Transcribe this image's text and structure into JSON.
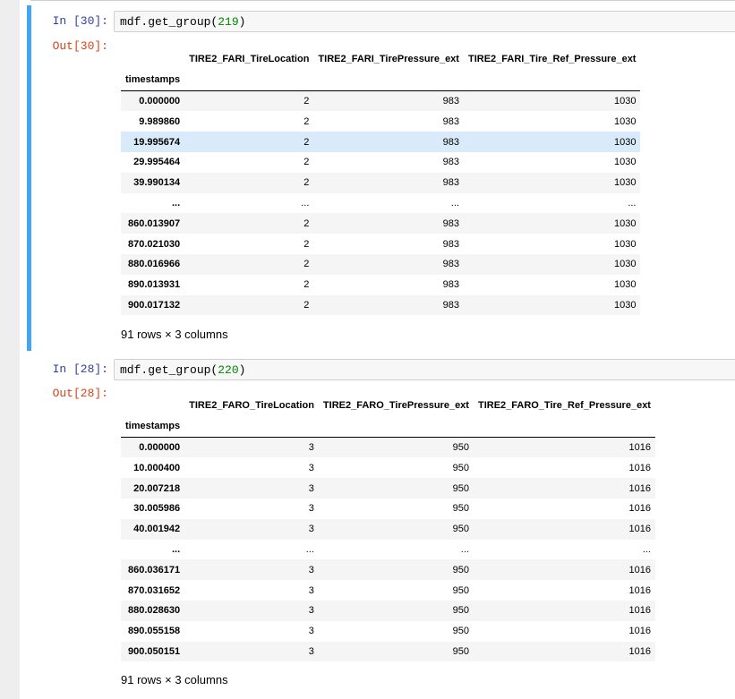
{
  "cell1": {
    "in_prompt": "In [30]:",
    "code_prefix": "mdf.get_group(",
    "code_arg": "219",
    "code_suffix": ")",
    "out_prompt": "Out[30]:",
    "index_name": "timestamps",
    "columns": [
      "TIRE2_FARI_TireLocation",
      "TIRE2_FARI_TirePressure_ext",
      "TIRE2_FARI_Tire_Ref_Pressure_ext"
    ],
    "rows": [
      [
        "0.000000",
        "2",
        "983",
        "1030"
      ],
      [
        "9.989860",
        "2",
        "983",
        "1030"
      ],
      [
        "19.995674",
        "2",
        "983",
        "1030"
      ],
      [
        "29.995464",
        "2",
        "983",
        "1030"
      ],
      [
        "39.990134",
        "2",
        "983",
        "1030"
      ],
      [
        "...",
        "...",
        "...",
        "..."
      ],
      [
        "860.013907",
        "2",
        "983",
        "1030"
      ],
      [
        "870.021030",
        "2",
        "983",
        "1030"
      ],
      [
        "880.016966",
        "2",
        "983",
        "1030"
      ],
      [
        "890.013931",
        "2",
        "983",
        "1030"
      ],
      [
        "900.017132",
        "2",
        "983",
        "1030"
      ]
    ],
    "shape": "91 rows × 3 columns"
  },
  "cell2": {
    "in_prompt": "In [28]:",
    "code_prefix": "mdf.get_group(",
    "code_arg": "220",
    "code_suffix": ")",
    "out_prompt": "Out[28]:",
    "index_name": "timestamps",
    "columns": [
      "TIRE2_FARO_TireLocation",
      "TIRE2_FARO_TirePressure_ext",
      "TIRE2_FARO_Tire_Ref_Pressure_ext"
    ],
    "rows": [
      [
        "0.000000",
        "3",
        "950",
        "1016"
      ],
      [
        "10.000400",
        "3",
        "950",
        "1016"
      ],
      [
        "20.007218",
        "3",
        "950",
        "1016"
      ],
      [
        "30.005986",
        "3",
        "950",
        "1016"
      ],
      [
        "40.001942",
        "3",
        "950",
        "1016"
      ],
      [
        "...",
        "...",
        "...",
        "..."
      ],
      [
        "860.036171",
        "3",
        "950",
        "1016"
      ],
      [
        "870.031652",
        "3",
        "950",
        "1016"
      ],
      [
        "880.028630",
        "3",
        "950",
        "1016"
      ],
      [
        "890.055158",
        "3",
        "950",
        "1016"
      ],
      [
        "900.050151",
        "3",
        "950",
        "1016"
      ]
    ],
    "shape": "91 rows × 3 columns"
  },
  "colors": {
    "selected_cell_bar": "#42a5f5",
    "in_prompt": "#303f9f",
    "out_prompt": "#d84315",
    "row_hover": "#d9ebfa"
  }
}
